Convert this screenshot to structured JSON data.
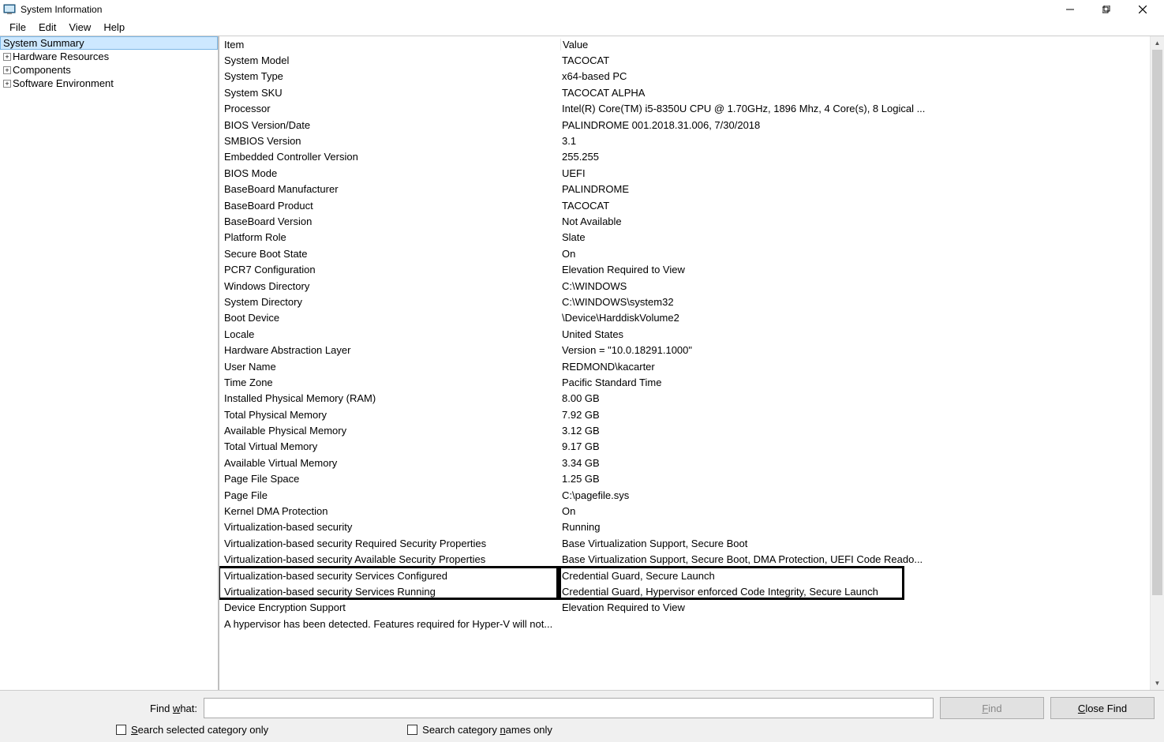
{
  "window": {
    "title": "System Information"
  },
  "menu": {
    "file": "File",
    "edit": "Edit",
    "view": "View",
    "help": "Help"
  },
  "tree": {
    "items": [
      {
        "label": "System Summary",
        "selected": true,
        "expandable": false
      },
      {
        "label": "Hardware Resources",
        "selected": false,
        "expandable": true,
        "indent": 1
      },
      {
        "label": "Components",
        "selected": false,
        "expandable": true,
        "indent": 1
      },
      {
        "label": "Software Environment",
        "selected": false,
        "expandable": true,
        "indent": 1
      }
    ]
  },
  "columns": {
    "item": "Item",
    "value": "Value"
  },
  "rows": [
    {
      "item": "System Model",
      "value": "TACOCAT"
    },
    {
      "item": "System Type",
      "value": "x64-based PC"
    },
    {
      "item": "System SKU",
      "value": "TACOCAT ALPHA"
    },
    {
      "item": "Processor",
      "value": "Intel(R) Core(TM) i5-8350U CPU @ 1.70GHz, 1896 Mhz, 4 Core(s), 8 Logical ..."
    },
    {
      "item": "BIOS Version/Date",
      "value": "PALINDROME 001.2018.31.006, 7/30/2018"
    },
    {
      "item": "SMBIOS Version",
      "value": "3.1"
    },
    {
      "item": "Embedded Controller Version",
      "value": "255.255"
    },
    {
      "item": "BIOS Mode",
      "value": "UEFI"
    },
    {
      "item": "BaseBoard Manufacturer",
      "value": "PALINDROME"
    },
    {
      "item": "BaseBoard Product",
      "value": "TACOCAT"
    },
    {
      "item": "BaseBoard Version",
      "value": "Not Available"
    },
    {
      "item": "Platform Role",
      "value": "Slate"
    },
    {
      "item": "Secure Boot State",
      "value": "On"
    },
    {
      "item": "PCR7 Configuration",
      "value": "Elevation Required to View"
    },
    {
      "item": "Windows Directory",
      "value": "C:\\WINDOWS"
    },
    {
      "item": "System Directory",
      "value": "C:\\WINDOWS\\system32"
    },
    {
      "item": "Boot Device",
      "value": "\\Device\\HarddiskVolume2"
    },
    {
      "item": "Locale",
      "value": "United States"
    },
    {
      "item": "Hardware Abstraction Layer",
      "value": "Version = \"10.0.18291.1000\""
    },
    {
      "item": "User Name",
      "value": "REDMOND\\kacarter"
    },
    {
      "item": "Time Zone",
      "value": "Pacific Standard Time"
    },
    {
      "item": "Installed Physical Memory (RAM)",
      "value": "8.00 GB"
    },
    {
      "item": "Total Physical Memory",
      "value": "7.92 GB"
    },
    {
      "item": "Available Physical Memory",
      "value": "3.12 GB"
    },
    {
      "item": "Total Virtual Memory",
      "value": "9.17 GB"
    },
    {
      "item": "Available Virtual Memory",
      "value": "3.34 GB"
    },
    {
      "item": "Page File Space",
      "value": "1.25 GB"
    },
    {
      "item": "Page File",
      "value": "C:\\pagefile.sys"
    },
    {
      "item": "Kernel DMA Protection",
      "value": "On"
    },
    {
      "item": "Virtualization-based security",
      "value": "Running"
    },
    {
      "item": "Virtualization-based security Required Security Properties",
      "value": "Base Virtualization Support, Secure Boot"
    },
    {
      "item": "Virtualization-based security Available Security Properties",
      "value": "Base Virtualization Support, Secure Boot, DMA Protection, UEFI Code Reado..."
    },
    {
      "item": "Virtualization-based security Services Configured",
      "value": "Credential Guard, Secure Launch",
      "highlight": true
    },
    {
      "item": "Virtualization-based security Services Running",
      "value": "Credential Guard, Hypervisor enforced Code Integrity, Secure Launch",
      "highlight": true
    },
    {
      "item": "Device Encryption Support",
      "value": "Elevation Required to View"
    },
    {
      "item": "A hypervisor has been detected. Features required for Hyper-V will not...",
      "value": ""
    }
  ],
  "find": {
    "label_prefix": "Find ",
    "label_ul": "w",
    "label_suffix": "hat:",
    "find_btn_ul": "F",
    "find_btn_suffix": "ind",
    "close_btn_ul": "C",
    "close_btn_suffix": "lose Find",
    "chk1_ul": "S",
    "chk1_suffix": "earch selected category only",
    "chk2_prefix": "Search category ",
    "chk2_ul": "n",
    "chk2_suffix": "ames only"
  }
}
